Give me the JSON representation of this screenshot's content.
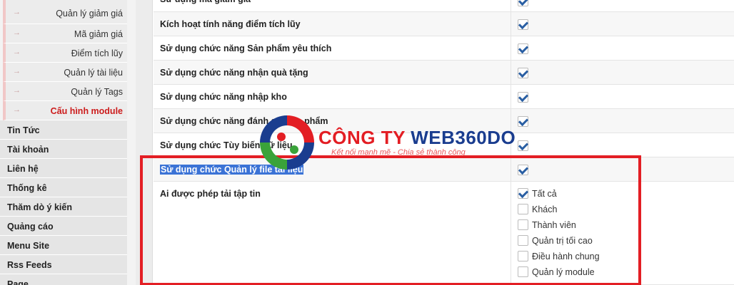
{
  "sidebar": {
    "sub_items": [
      {
        "label": "Quản lý giảm giá",
        "active": false
      },
      {
        "label": "Mã giảm giá",
        "active": false
      },
      {
        "label": "Điểm tích lũy",
        "active": false
      },
      {
        "label": "Quản lý tài liệu",
        "active": false
      },
      {
        "label": "Quản lý Tags",
        "active": false
      },
      {
        "label": "Cấu hình module",
        "active": true
      }
    ],
    "arrow": "→",
    "main_items": [
      "Tin Tức",
      "Tài khoản",
      "Liên hệ",
      "Thống kê",
      "Thăm dò ý kiến",
      "Quảng cáo",
      "Menu Site",
      "Rss Feeds",
      "Page"
    ]
  },
  "settings": {
    "rows": [
      {
        "label": "Sử dụng mã giảm giá",
        "checked": true
      },
      {
        "label": "Kích hoạt tính năng điểm tích lũy",
        "checked": true
      },
      {
        "label": "Sử dụng chức năng Sản phẩm yêu thích",
        "checked": true
      },
      {
        "label": "Sử dụng chức năng nhận quà tặng",
        "checked": true
      },
      {
        "label": "Sử dụng chức năng nhập kho",
        "checked": true
      },
      {
        "label": "Sử dụng chức năng đánh giá sản phẩm",
        "checked": true
      },
      {
        "label": "Sử dụng chức Tùy biến dữ liệu",
        "checked": true
      },
      {
        "label": "Sử dụng chức Quản lý file tài liệu",
        "checked": true
      }
    ],
    "download_permission": {
      "label": "Ai được phép tải tập tin",
      "options": [
        {
          "label": "Tất cả",
          "checked": true
        },
        {
          "label": "Khách",
          "checked": false
        },
        {
          "label": "Thành viên",
          "checked": false
        },
        {
          "label": "Quản trị tối cao",
          "checked": false
        },
        {
          "label": "Điều hành chung",
          "checked": false
        },
        {
          "label": "Quản lý module",
          "checked": false
        }
      ]
    }
  },
  "watermark": {
    "title_part1": "CÔNG TY ",
    "title_part2": "WEB360DO",
    "slogan": "Kết nối mạnh mẽ - Chia sẻ thành công",
    "colors": {
      "red": "#e31e24",
      "blue": "#1a3d8f",
      "green": "#3aa33a"
    }
  },
  "colors": {
    "accent_red": "#e31e24",
    "active_menu": "#cc1c1c",
    "selection": "#3b73d6",
    "checkmark": "#2a5fa3"
  }
}
